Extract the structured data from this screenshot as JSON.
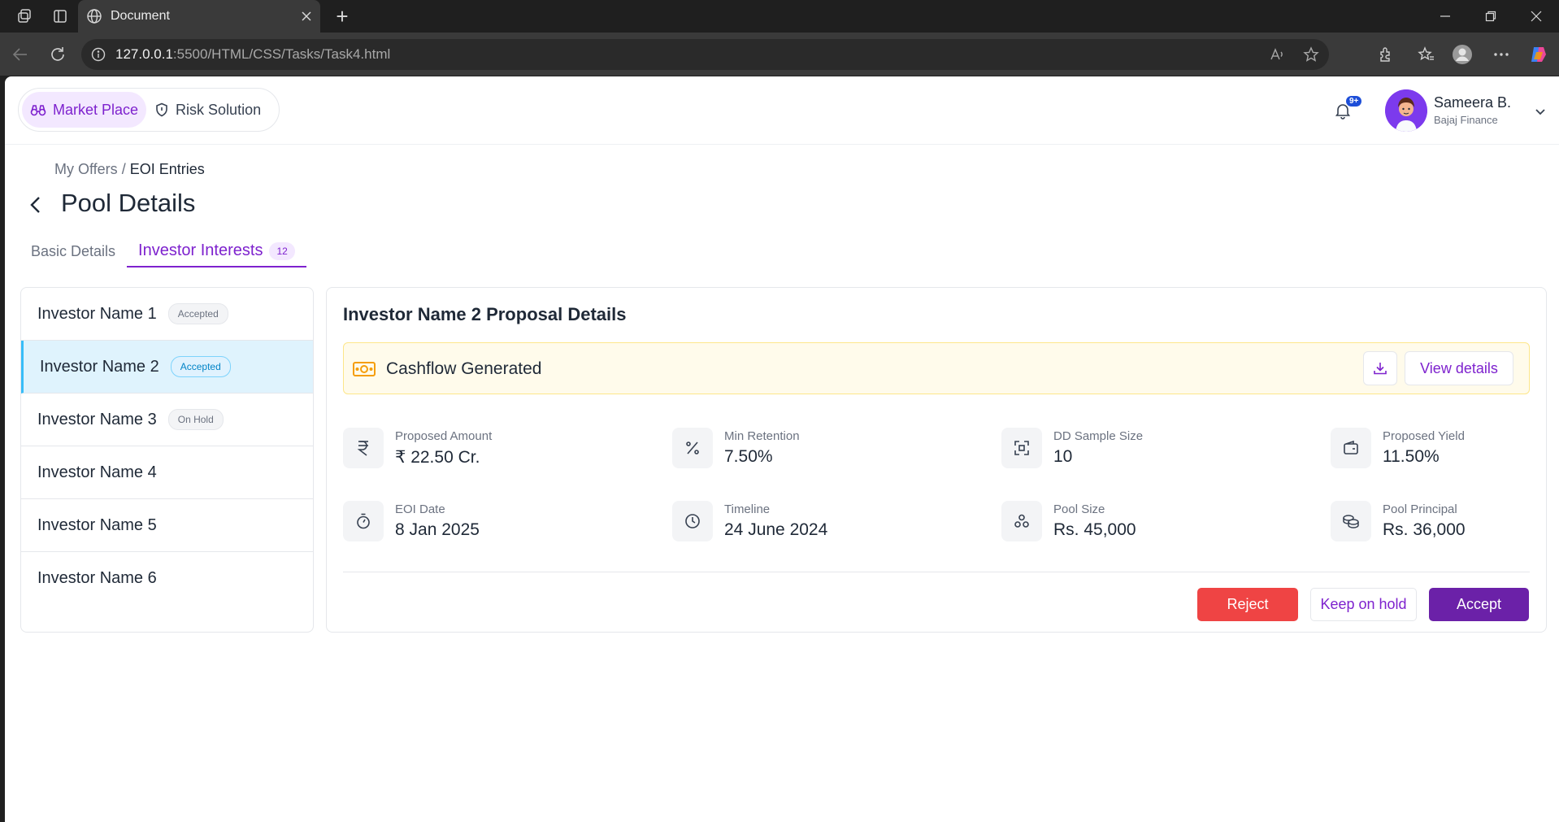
{
  "browser": {
    "tab_title": "Document",
    "url_host": "127.0.0.1",
    "url_path": ":5500/HTML/CSS/Tasks/Task4.html"
  },
  "header": {
    "segments": [
      {
        "label": "Market Place",
        "active": true
      },
      {
        "label": "Risk Solution",
        "active": false
      }
    ],
    "notification_badge": "9+",
    "user_name": "Sameera B.",
    "user_org": "Bajaj Finance"
  },
  "breadcrumb": {
    "parent": "My Offers",
    "separator": "/",
    "current": "EOI Entries"
  },
  "page_title": "Pool Details",
  "tabs": [
    {
      "label": "Basic Details",
      "active": false
    },
    {
      "label": "Investor Interests",
      "active": true,
      "count": "12"
    }
  ],
  "investors": [
    {
      "name": "Investor Name 1",
      "status": "Accepted"
    },
    {
      "name": "Investor Name 2",
      "status": "Accepted",
      "selected": true
    },
    {
      "name": "Investor Name 3",
      "status": "On Hold"
    },
    {
      "name": "Investor Name 4"
    },
    {
      "name": "Investor Name 5"
    },
    {
      "name": "Investor Name 6"
    }
  ],
  "details": {
    "title": "Investor Name 2 Proposal Details",
    "cashflow_label": "Cashflow Generated",
    "view_details_label": "View details",
    "metrics": [
      {
        "label": "Proposed Amount",
        "value": "₹ 22.50 Cr.",
        "icon": "rupee-icon"
      },
      {
        "label": "Min Retention",
        "value": "7.50%",
        "icon": "percent-icon"
      },
      {
        "label": "DD Sample Size",
        "value": "10",
        "icon": "scan-icon"
      },
      {
        "label": "Proposed Yield",
        "value": "11.50%",
        "icon": "wallet-icon"
      },
      {
        "label": "EOI Date",
        "value": "8 Jan 2025",
        "icon": "stopwatch-icon"
      },
      {
        "label": "Timeline",
        "value": "24 June 2024",
        "icon": "clock-icon"
      },
      {
        "label": "Pool Size",
        "value": "Rs. 45,000",
        "icon": "circles-icon"
      },
      {
        "label": "Pool Principal",
        "value": "Rs. 36,000",
        "icon": "coins-icon"
      }
    ],
    "actions": {
      "reject": "Reject",
      "hold": "Keep on hold",
      "accept": "Accept"
    }
  },
  "colors": {
    "accent": "#7e22ce",
    "reject": "#ef4444",
    "selected_row": "#dff3fd",
    "cashflow_bg": "#fffbeb"
  }
}
